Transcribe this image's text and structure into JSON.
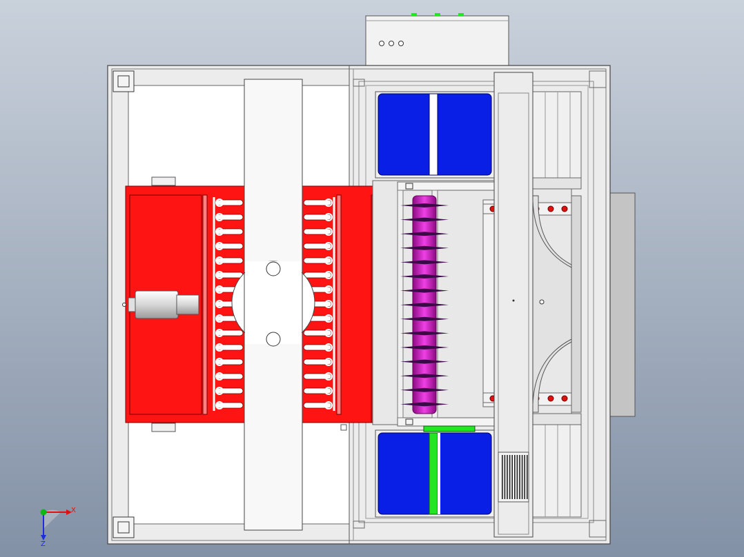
{
  "viewport": {
    "background_top": "#c9d1db",
    "background_bottom": "#8391a6"
  },
  "colors": {
    "frame_fill": "#ececec",
    "frame_stroke": "#555555",
    "heater_red": "#ff1414",
    "heater_dark_red": "#d42020",
    "roller_magenta": "#d21ec8",
    "tank_blue": "#0a1fe6",
    "marker_green": "#22e622",
    "hole_red": "#e01010",
    "axis_x": "#e01010",
    "axis_y": "#12b812",
    "axis_z": "#1a2ee0"
  },
  "triad": {
    "x_label": "X",
    "z_label": "Z"
  }
}
